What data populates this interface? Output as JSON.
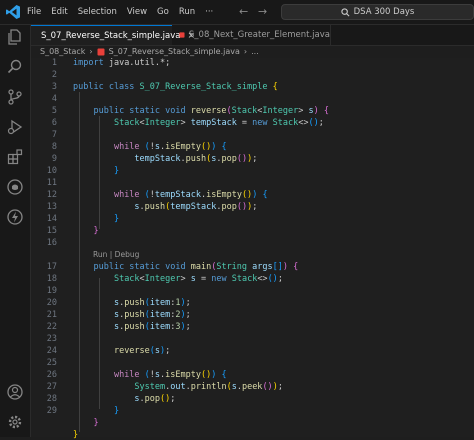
{
  "menu": [
    "File",
    "Edit",
    "Selection",
    "View",
    "Go",
    "Run",
    "···"
  ],
  "search": {
    "label": "DSA 300 Days"
  },
  "tabs": [
    {
      "label": "S_07_Reverse_Stack_simple.java",
      "close": "×"
    },
    {
      "label": "S_08_Next_Greater_Element.java"
    }
  ],
  "breadcrumb": {
    "folder": "S_08_Stack",
    "file": "S_07_Reverse_Stack_simple.java",
    "ellipsis": "..."
  },
  "codelens": "Run | Debug",
  "editor": {
    "line_numbers": [
      "1",
      "2",
      "3",
      "4",
      "5",
      "6",
      "7",
      "8",
      "9",
      "10",
      "11",
      "12",
      "13",
      "14",
      "15",
      "16",
      "17",
      "18",
      "19",
      "20",
      "21",
      "22",
      "23",
      "24",
      "25",
      "26",
      "27",
      "28",
      "29"
    ],
    "line_number_map": [
      0,
      1,
      2,
      3,
      4,
      5,
      6,
      7,
      8,
      9,
      10,
      11,
      12,
      13,
      14,
      15,
      null,
      16,
      17,
      18,
      19,
      20,
      21,
      22,
      23,
      24,
      25,
      26,
      27,
      28
    ],
    "lines": [
      [
        [
          "kw",
          "import"
        ],
        [
          "pn",
          " java.util.*;"
        ]
      ],
      [],
      [
        [
          "kw",
          "public class "
        ],
        [
          "ty",
          "S_07_Reverse_Stack_simple"
        ],
        [
          "pn",
          " "
        ],
        [
          "b1",
          "{"
        ]
      ],
      [],
      [
        [
          "pn",
          "    "
        ],
        [
          "kw",
          "public static void "
        ],
        [
          "fn",
          "reverse"
        ],
        [
          "b2",
          "("
        ],
        [
          "ty",
          "Stack"
        ],
        [
          "pn",
          "<"
        ],
        [
          "ty",
          "Integer"
        ],
        [
          "pn",
          "> "
        ],
        [
          "var",
          "s"
        ],
        [
          "b2",
          ")"
        ],
        [
          "pn",
          " "
        ],
        [
          "b2",
          "{"
        ]
      ],
      [
        [
          "pn",
          "        "
        ],
        [
          "ty",
          "Stack"
        ],
        [
          "pn",
          "<"
        ],
        [
          "ty",
          "Integer"
        ],
        [
          "pn",
          "> "
        ],
        [
          "var",
          "tempStack"
        ],
        [
          "pn",
          " = "
        ],
        [
          "kw",
          "new "
        ],
        [
          "ty",
          "Stack"
        ],
        [
          "pn",
          "<>"
        ],
        [
          "b3",
          "()"
        ],
        [
          "pn",
          ";"
        ]
      ],
      [],
      [
        [
          "pn",
          "        "
        ],
        [
          "ctl",
          "while "
        ],
        [
          "b3",
          "("
        ],
        [
          "pn",
          "!"
        ],
        [
          "var",
          "s"
        ],
        [
          "pn",
          "."
        ],
        [
          "fn",
          "isEmpty"
        ],
        [
          "b1",
          "()"
        ],
        [
          "b3",
          ")"
        ],
        [
          "pn",
          " "
        ],
        [
          "b3",
          "{"
        ]
      ],
      [
        [
          "pn",
          "            "
        ],
        [
          "var",
          "tempStack"
        ],
        [
          "pn",
          "."
        ],
        [
          "fn",
          "push"
        ],
        [
          "b1",
          "("
        ],
        [
          "var",
          "s"
        ],
        [
          "pn",
          "."
        ],
        [
          "fn",
          "pop"
        ],
        [
          "b2",
          "()"
        ],
        [
          "b1",
          ")"
        ],
        [
          "pn",
          ";"
        ]
      ],
      [
        [
          "pn",
          "        "
        ],
        [
          "b3",
          "}"
        ]
      ],
      [],
      [
        [
          "pn",
          "        "
        ],
        [
          "ctl",
          "while "
        ],
        [
          "b3",
          "("
        ],
        [
          "pn",
          "!"
        ],
        [
          "var",
          "tempStack"
        ],
        [
          "pn",
          "."
        ],
        [
          "fn",
          "isEmpty"
        ],
        [
          "b1",
          "()"
        ],
        [
          "b3",
          ")"
        ],
        [
          "pn",
          " "
        ],
        [
          "b3",
          "{"
        ]
      ],
      [
        [
          "pn",
          "            "
        ],
        [
          "var",
          "s"
        ],
        [
          "pn",
          "."
        ],
        [
          "fn",
          "push"
        ],
        [
          "b1",
          "("
        ],
        [
          "var",
          "tempStack"
        ],
        [
          "pn",
          "."
        ],
        [
          "fn",
          "pop"
        ],
        [
          "b2",
          "()"
        ],
        [
          "b1",
          ")"
        ],
        [
          "pn",
          ";"
        ]
      ],
      [
        [
          "pn",
          "        "
        ],
        [
          "b3",
          "}"
        ]
      ],
      [
        [
          "pn",
          "    "
        ],
        [
          "b2",
          "}"
        ]
      ],
      [],
      null,
      [
        [
          "pn",
          "    "
        ],
        [
          "kw",
          "public static void "
        ],
        [
          "fn",
          "main"
        ],
        [
          "b2",
          "("
        ],
        [
          "ty",
          "String"
        ],
        [
          "pn",
          " "
        ],
        [
          "var",
          "args"
        ],
        [
          "b3",
          "[]"
        ],
        [
          "b2",
          ")"
        ],
        [
          "pn",
          " "
        ],
        [
          "b2",
          "{"
        ]
      ],
      [
        [
          "pn",
          "        "
        ],
        [
          "ty",
          "Stack"
        ],
        [
          "pn",
          "<"
        ],
        [
          "ty",
          "Integer"
        ],
        [
          "pn",
          "> "
        ],
        [
          "var",
          "s"
        ],
        [
          "pn",
          " = "
        ],
        [
          "kw",
          "new "
        ],
        [
          "ty",
          "Stack"
        ],
        [
          "pn",
          "<>"
        ],
        [
          "b3",
          "()"
        ],
        [
          "pn",
          ";"
        ]
      ],
      [],
      [
        [
          "pn",
          "        "
        ],
        [
          "var",
          "s"
        ],
        [
          "pn",
          "."
        ],
        [
          "fn",
          "push"
        ],
        [
          "b3",
          "("
        ],
        [
          "var",
          "item"
        ],
        [
          "pn",
          ":"
        ],
        [
          "num",
          "1"
        ],
        [
          "b3",
          ")"
        ],
        [
          "pn",
          ";"
        ]
      ],
      [
        [
          "pn",
          "        "
        ],
        [
          "var",
          "s"
        ],
        [
          "pn",
          "."
        ],
        [
          "fn",
          "push"
        ],
        [
          "b3",
          "("
        ],
        [
          "var",
          "item"
        ],
        [
          "pn",
          ":"
        ],
        [
          "num",
          "2"
        ],
        [
          "b3",
          ")"
        ],
        [
          "pn",
          ";"
        ]
      ],
      [
        [
          "pn",
          "        "
        ],
        [
          "var",
          "s"
        ],
        [
          "pn",
          "."
        ],
        [
          "fn",
          "push"
        ],
        [
          "b3",
          "("
        ],
        [
          "var",
          "item"
        ],
        [
          "pn",
          ":"
        ],
        [
          "num",
          "3"
        ],
        [
          "b3",
          ")"
        ],
        [
          "pn",
          ";"
        ]
      ],
      [],
      [
        [
          "pn",
          "        "
        ],
        [
          "fn",
          "reverse"
        ],
        [
          "b3",
          "("
        ],
        [
          "var",
          "s"
        ],
        [
          "b3",
          ")"
        ],
        [
          "pn",
          ";"
        ]
      ],
      [],
      [
        [
          "pn",
          "        "
        ],
        [
          "ctl",
          "while "
        ],
        [
          "b3",
          "("
        ],
        [
          "pn",
          "!"
        ],
        [
          "var",
          "s"
        ],
        [
          "pn",
          "."
        ],
        [
          "fn",
          "isEmpty"
        ],
        [
          "b1",
          "()"
        ],
        [
          "b3",
          ")"
        ],
        [
          "pn",
          " "
        ],
        [
          "b3",
          "{"
        ]
      ],
      [
        [
          "pn",
          "            "
        ],
        [
          "ty",
          "System"
        ],
        [
          "pn",
          "."
        ],
        [
          "var",
          "out"
        ],
        [
          "pn",
          "."
        ],
        [
          "fn",
          "println"
        ],
        [
          "b1",
          "("
        ],
        [
          "var",
          "s"
        ],
        [
          "pn",
          "."
        ],
        [
          "fn",
          "peek"
        ],
        [
          "b2",
          "()"
        ],
        [
          "b1",
          ")"
        ],
        [
          "pn",
          ";"
        ]
      ],
      [
        [
          "pn",
          "            "
        ],
        [
          "var",
          "s"
        ],
        [
          "pn",
          "."
        ],
        [
          "fn",
          "pop"
        ],
        [
          "b1",
          "()"
        ],
        [
          "pn",
          ";"
        ]
      ],
      [
        [
          "pn",
          "        "
        ],
        [
          "b3",
          "}"
        ]
      ],
      [
        [
          "pn",
          "    "
        ],
        [
          "b2",
          "}"
        ]
      ],
      [
        [
          "b1",
          "}"
        ]
      ]
    ]
  },
  "colors": {
    "accent": "#0078d4",
    "keyword": "#569cd6",
    "control": "#c586c0",
    "type": "#4ec9b0",
    "function": "#dcdcaa",
    "variable": "#9cdcfe",
    "number": "#b5cea8"
  },
  "icons": [
    "vscode-logo-icon",
    "back-arrow-icon",
    "forward-arrow-icon",
    "search-icon",
    "explorer-icon",
    "search-activity-icon",
    "source-control-icon",
    "run-debug-icon",
    "extensions-icon",
    "github-icon",
    "thunder-client-icon",
    "account-icon",
    "settings-gear-icon",
    "java-file-icon",
    "close-icon"
  ]
}
